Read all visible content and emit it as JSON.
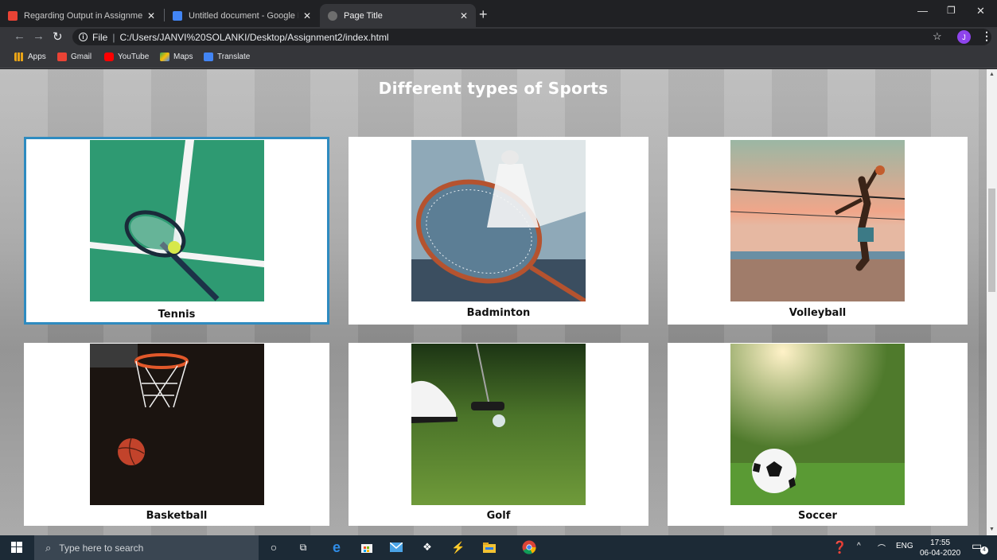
{
  "browser": {
    "tabs": [
      {
        "label": "Regarding Output in Assignment",
        "icon": "gmail-icon"
      },
      {
        "label": "Untitled document - Google Doc",
        "icon": "docs-icon"
      },
      {
        "label": "Page Title",
        "icon": "globe-icon"
      }
    ],
    "new_tab": "+",
    "url_prefix": "File",
    "url": "C:/Users/JANVI%20SOLANKI/Desktop/Assignment2/index.html",
    "profile_initial": "J",
    "bookmarks": [
      {
        "label": "Apps",
        "color": "#e8a317"
      },
      {
        "label": "Gmail",
        "color": "#ea4335"
      },
      {
        "label": "YouTube",
        "color": "#ff0000"
      },
      {
        "label": "Maps",
        "color": "#34a853"
      },
      {
        "label": "Translate",
        "color": "#4285f4"
      }
    ]
  },
  "page": {
    "title": "Different types of Sports",
    "cards": [
      {
        "caption": "Tennis",
        "selected": true
      },
      {
        "caption": "Badminton",
        "selected": false
      },
      {
        "caption": "Volleyball",
        "selected": false
      },
      {
        "caption": "Basketball",
        "selected": false
      },
      {
        "caption": "Golf",
        "selected": false
      },
      {
        "caption": "Soccer",
        "selected": false
      }
    ]
  },
  "taskbar": {
    "search_placeholder": "Type here to search",
    "language": "ENG",
    "time": "17:55",
    "date": "06-04-2020",
    "notifications": "4"
  }
}
